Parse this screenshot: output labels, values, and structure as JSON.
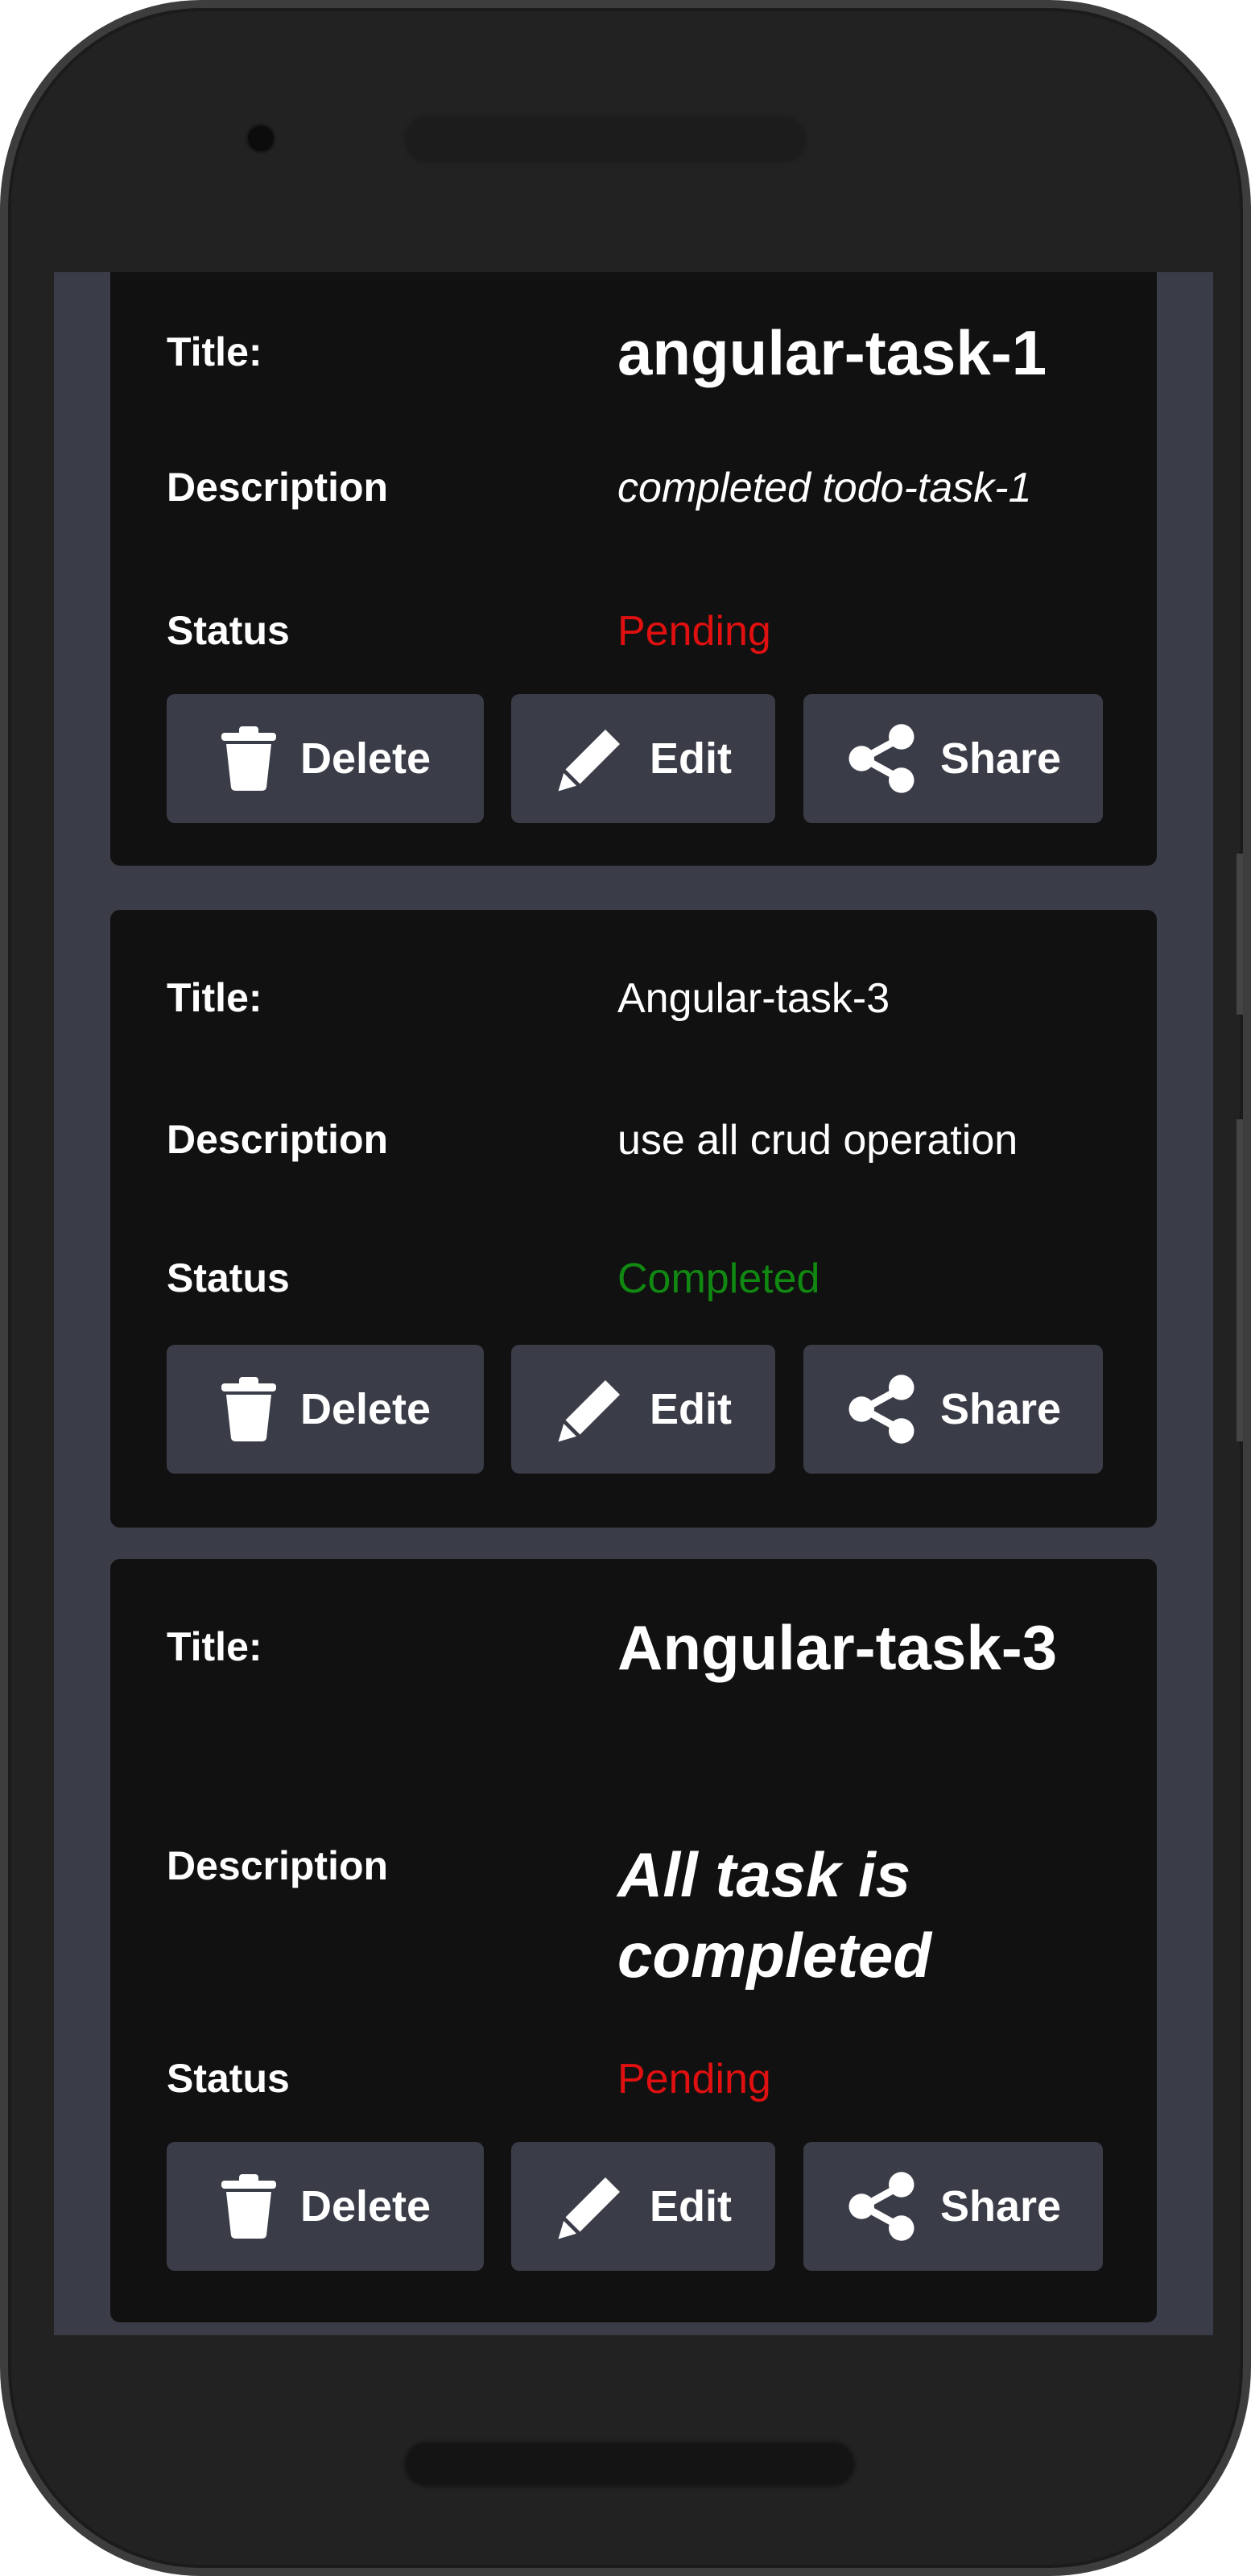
{
  "labels": {
    "title": "Title:",
    "description": "Description",
    "status": "Status"
  },
  "buttons": {
    "delete": "Delete",
    "edit": "Edit",
    "share": "Share"
  },
  "icons": {
    "delete": "trash-icon",
    "edit": "pencil-icon",
    "share": "share-icon"
  },
  "colors": {
    "screen_bg": "#3a3c48",
    "card_bg": "#111111",
    "pending": "#e01010",
    "completed": "#118811"
  },
  "tasks": [
    {
      "title": "angular-task-1",
      "description": "completed todo-task-1",
      "status": "Pending"
    },
    {
      "title": "Angular-task-3",
      "description": "use all crud operation",
      "status": "Completed"
    },
    {
      "title": "Angular-task-3",
      "description": "All task is completed",
      "status": "Pending"
    }
  ]
}
